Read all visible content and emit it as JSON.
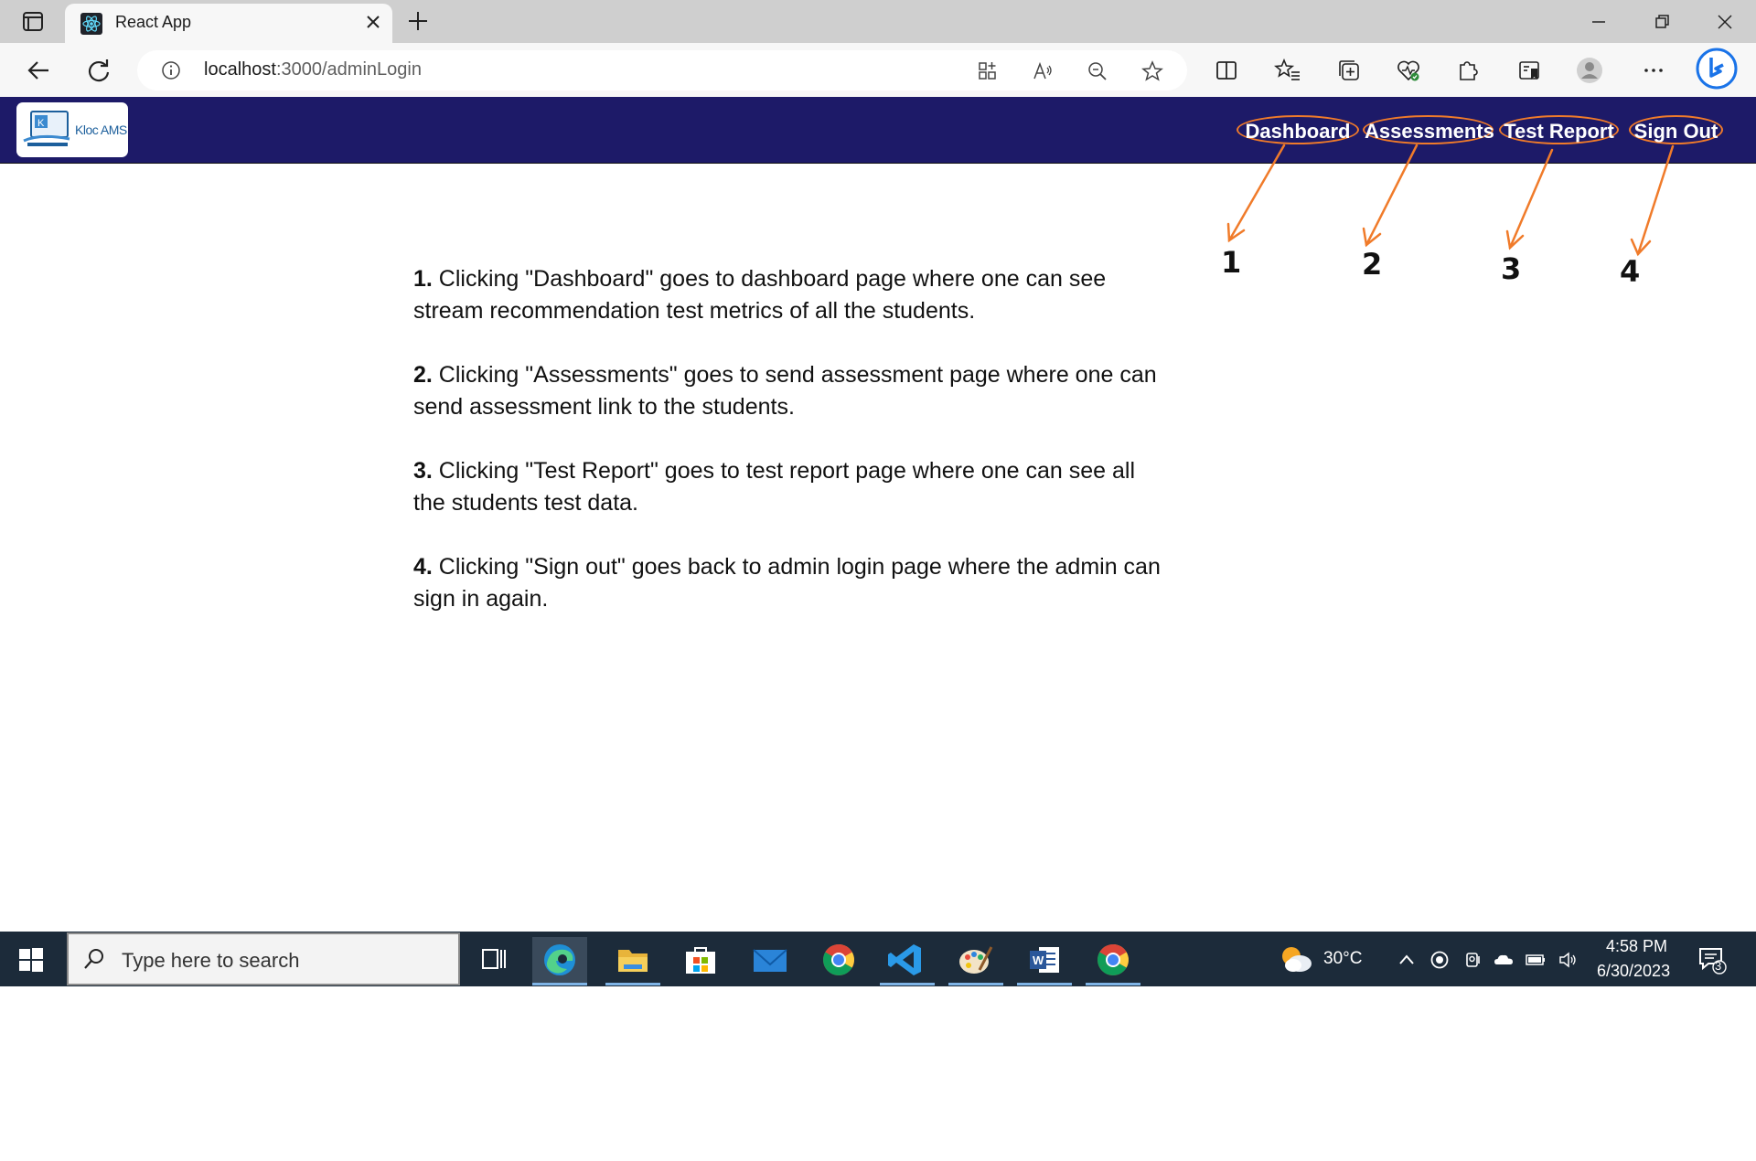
{
  "browser": {
    "tab_title": "React App",
    "url_host": "localhost",
    "url_rest": ":3000/adminLogin"
  },
  "navbar": {
    "logo_text": "Kloc AMS",
    "links": [
      "Dashboard",
      "Assessments",
      "Test Report",
      "Sign Out"
    ]
  },
  "annotations": [
    "1",
    "2",
    "3",
    "4"
  ],
  "instructions": [
    {
      "num": "1.",
      "text": " Clicking \"Dashboard\" goes to dashboard page where one can see stream recommendation test metrics of all the students."
    },
    {
      "num": "2.",
      "text": " Clicking \"Assessments\" goes to send assessment page where one can send assessment link to the students."
    },
    {
      "num": "3.",
      "text": " Clicking \"Test Report\" goes to test report page where one can see all the students test data."
    },
    {
      "num": "4.",
      "text": " Clicking \"Sign out\" goes back to admin login page where the admin can sign in again."
    }
  ],
  "taskbar": {
    "search_placeholder": "Type here to search",
    "weather": "30°C",
    "time": "4:58 PM",
    "date": "6/30/2023",
    "notification_count": "3"
  },
  "colors": {
    "navbar_bg": "#1d1a68",
    "annotation": "#f07b2a",
    "taskbar_bg": "#1c2b3a"
  }
}
